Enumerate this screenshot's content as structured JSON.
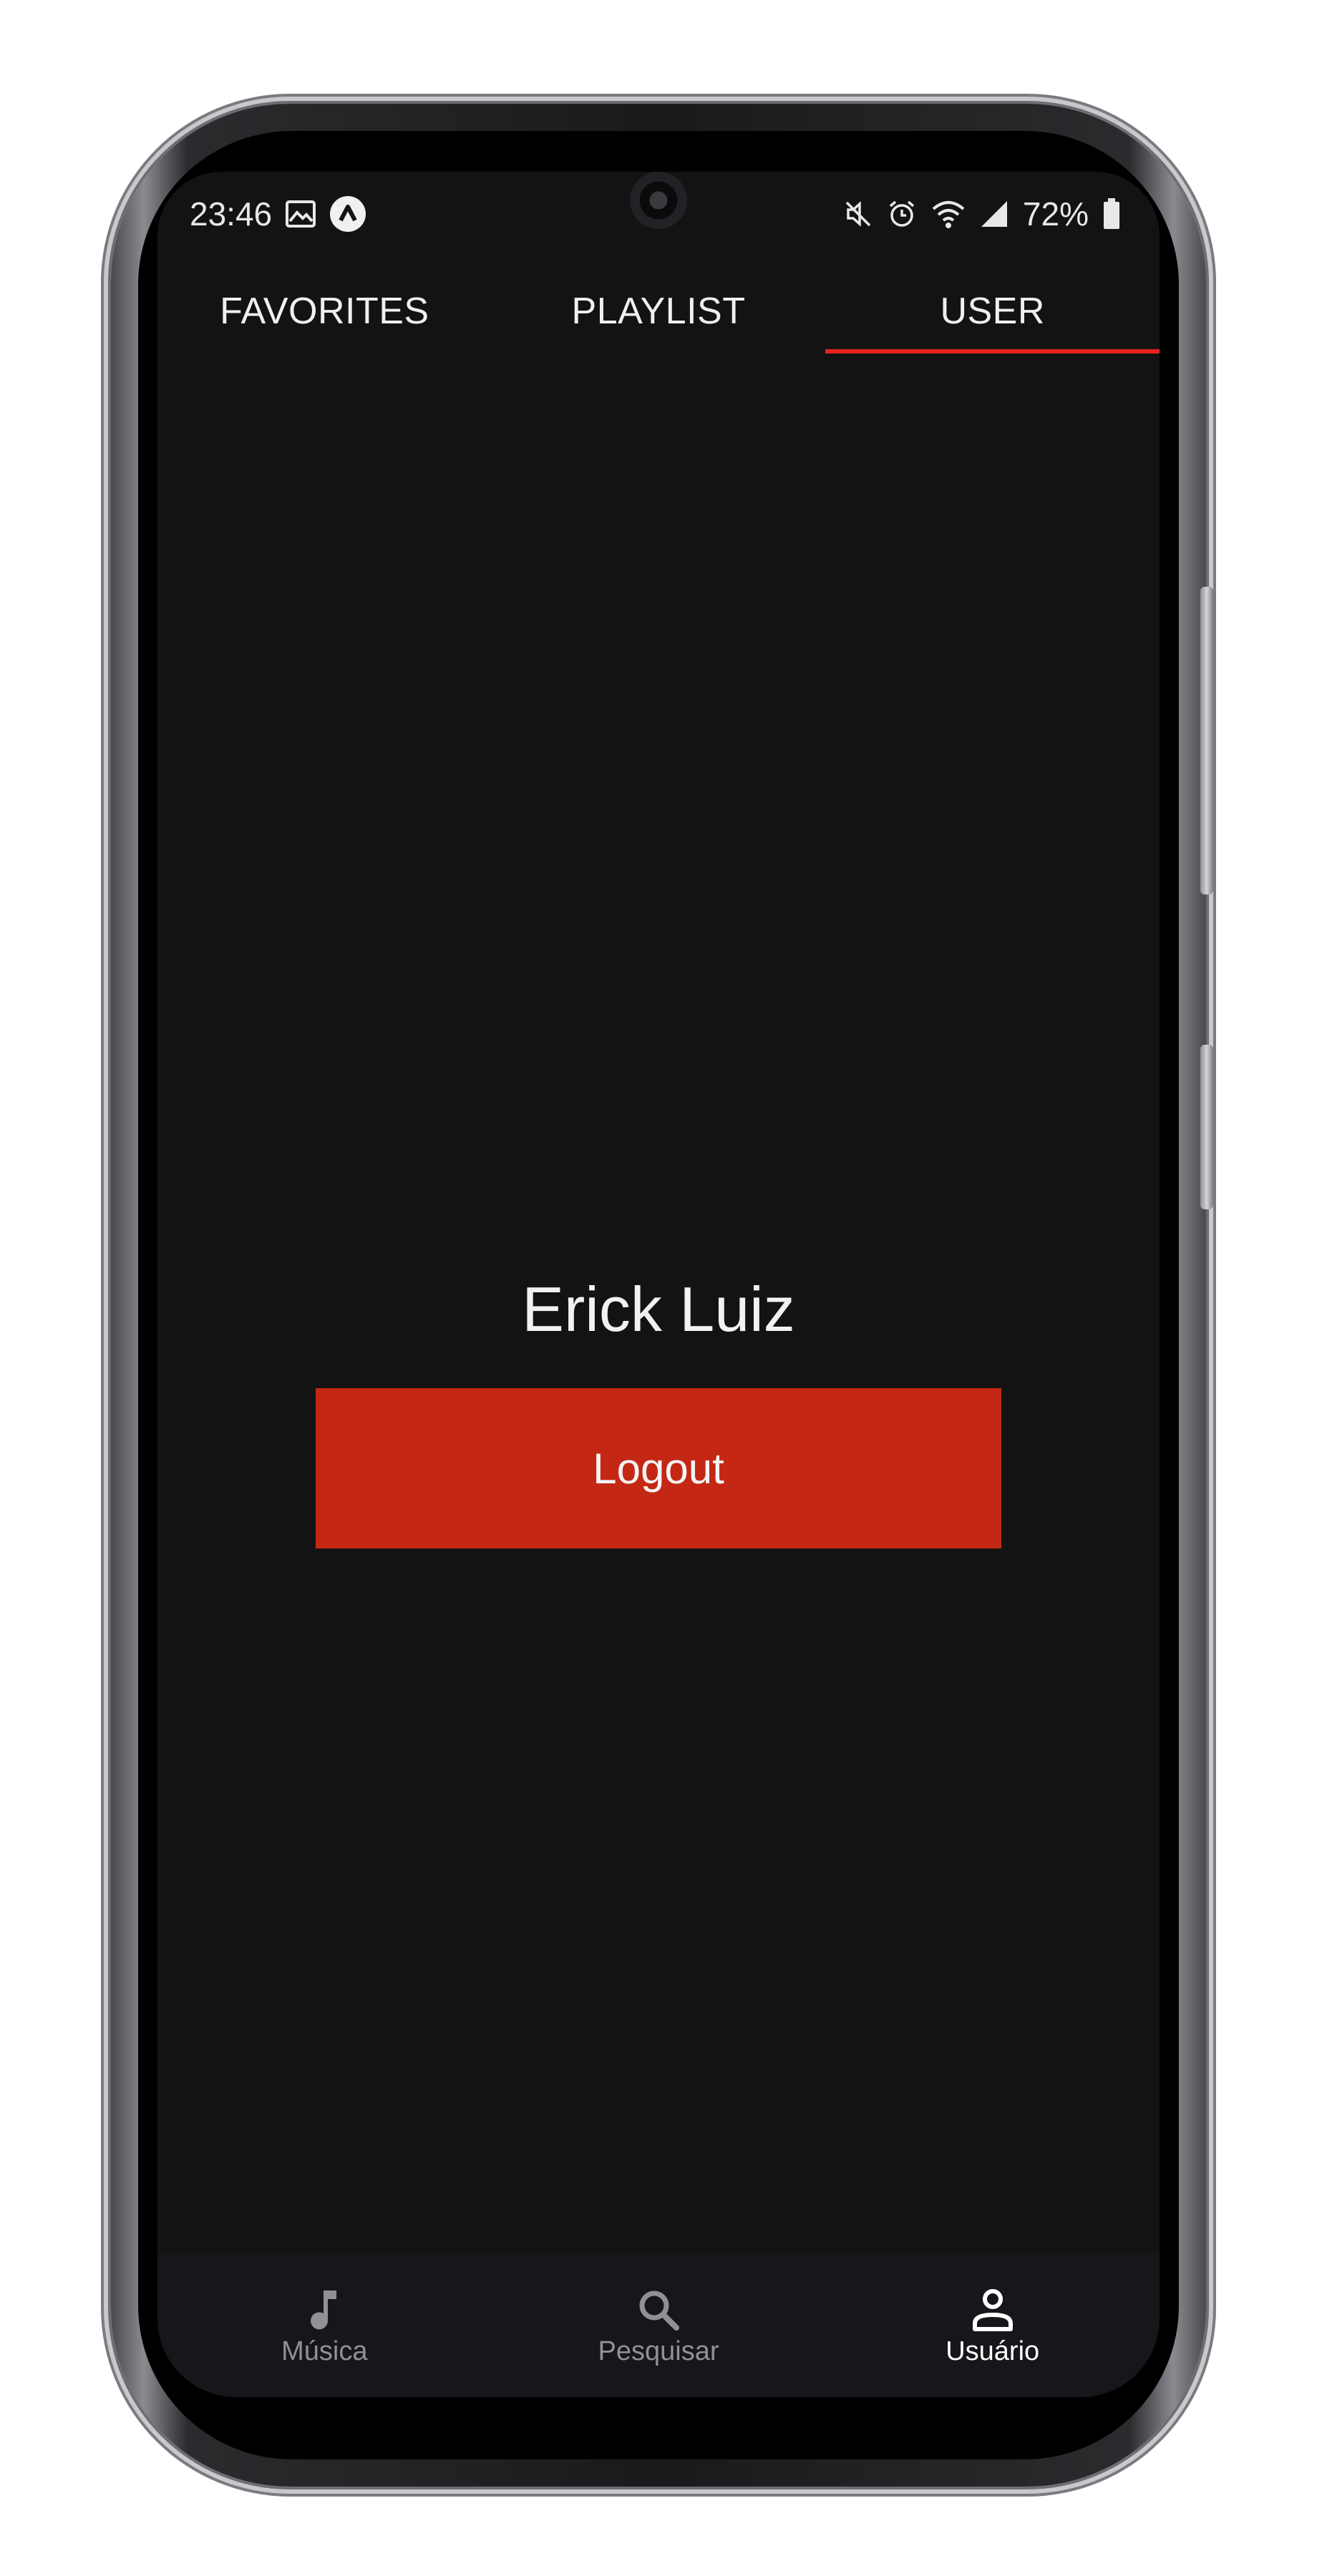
{
  "status_bar": {
    "time": "23:46",
    "battery": "72%"
  },
  "tabs": [
    {
      "label": "FAVORITES",
      "active": false
    },
    {
      "label": "PLAYLIST",
      "active": false
    },
    {
      "label": "USER",
      "active": true
    }
  ],
  "user": {
    "name": "Erick Luiz",
    "logout_label": "Logout"
  },
  "bottom_nav": [
    {
      "label": "Música",
      "icon": "music-note-icon",
      "active": false
    },
    {
      "label": "Pesquisar",
      "icon": "search-icon",
      "active": false
    },
    {
      "label": "Usuário",
      "icon": "user-icon",
      "active": true
    }
  ],
  "colors": {
    "accent": "#e8231c",
    "button": "#c42815",
    "background": "#131314"
  }
}
